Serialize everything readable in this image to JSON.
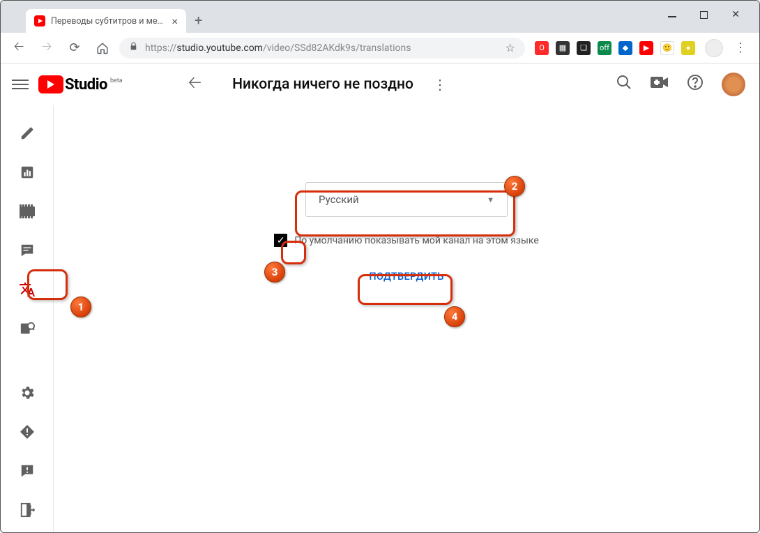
{
  "window": {
    "minimize": "—",
    "maximize": "☐",
    "close": "✕"
  },
  "browser": {
    "tab_title": "Переводы субтитров и метадан…",
    "tab_close": "×",
    "new_tab": "+",
    "url_prefix": "https://",
    "url_host": "studio.youtube.com",
    "url_path": "/video/SSd82AKdk9s/translations"
  },
  "header": {
    "logo_text": "Studio",
    "logo_beta": "beta",
    "video_title": "Никогда ничего не поздно"
  },
  "sidebar": {
    "items": [
      "edit",
      "analytics",
      "editor",
      "comments",
      "translate",
      "other"
    ],
    "bottom": [
      "settings",
      "report",
      "feedback",
      "exit"
    ]
  },
  "form": {
    "language": "Русский",
    "checkbox_label": "По умолчанию показывать мой канал на этом языке",
    "confirm": "ПОДТВЕРДИТЬ"
  },
  "annotations": {
    "b1": "1",
    "b2": "2",
    "b3": "3",
    "b4": "4"
  }
}
